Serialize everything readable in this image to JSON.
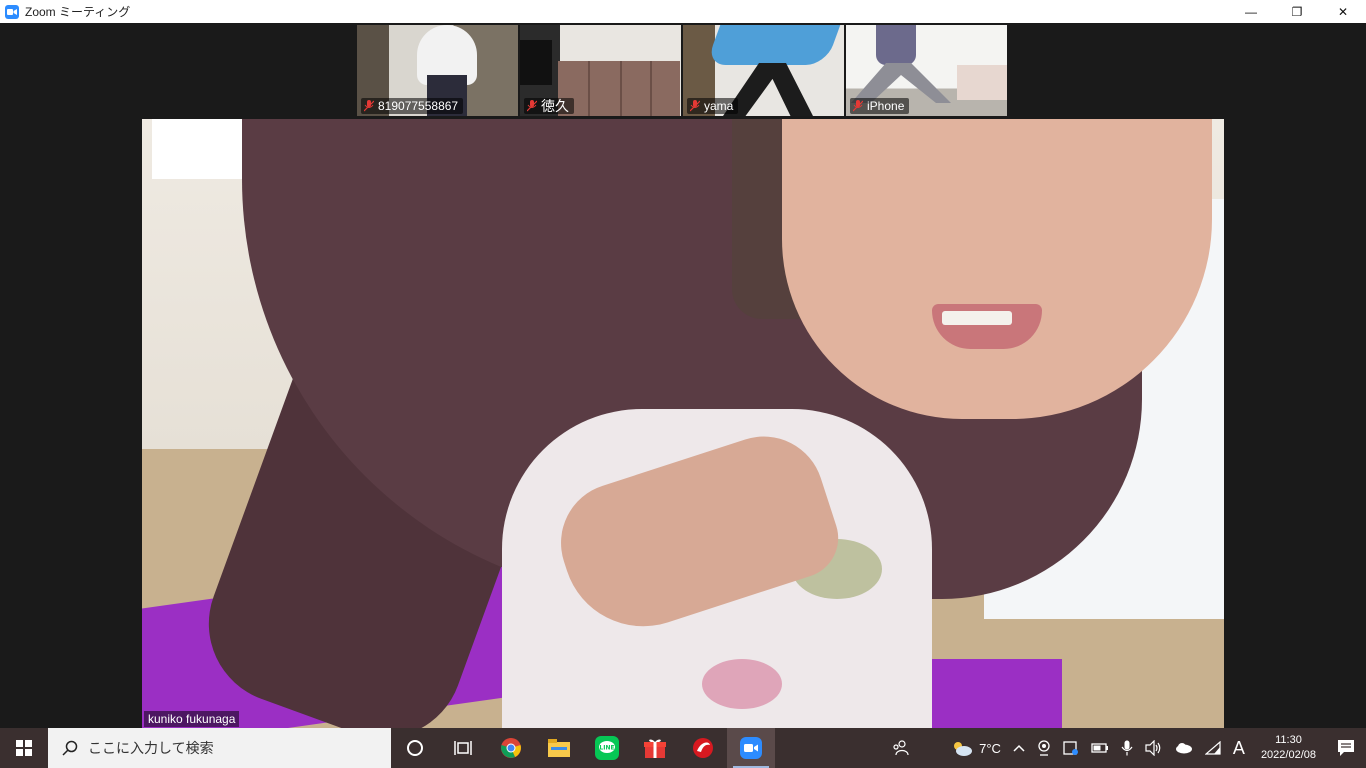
{
  "window": {
    "title": "Zoom ミーティング",
    "controls": {
      "minimize": "—",
      "restore": "❐",
      "close": "✕"
    }
  },
  "participants": [
    {
      "name": "819077558867",
      "muted": true
    },
    {
      "name": "徳久",
      "muted": true
    },
    {
      "name": "yama",
      "muted": true
    },
    {
      "name": "iPhone",
      "muted": true
    }
  ],
  "main_video": {
    "speaker_name": "kuniko fukunaga"
  },
  "taskbar": {
    "search_placeholder": "ここに入力して検索",
    "apps": [
      "cortana-icon",
      "task-view-icon",
      "chrome-icon",
      "file-explorer-icon",
      "line-icon",
      "gift-icon",
      "trend-micro-icon",
      "zoom-icon"
    ],
    "weather": "7°C",
    "ime": "A",
    "time": "11:30",
    "date": "2022/02/08"
  },
  "colors": {
    "accent": "#2d8cff",
    "taskbar": "#3a2f2f",
    "muted": "#e53935"
  }
}
